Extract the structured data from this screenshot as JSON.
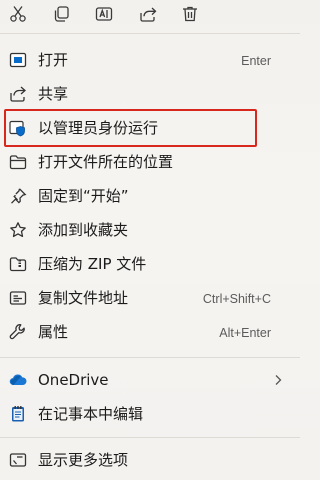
{
  "toolbar": {
    "buttons": [
      {
        "name": "cut-icon"
      },
      {
        "name": "copy-icon"
      },
      {
        "name": "rename-icon"
      },
      {
        "name": "share-icon"
      },
      {
        "name": "delete-icon"
      }
    ]
  },
  "menu": {
    "open": {
      "label": "打开",
      "shortcut": "Enter",
      "icon": "app-window-icon"
    },
    "share": {
      "label": "共享",
      "icon": "share-icon"
    },
    "run_as_admin": {
      "label": "以管理员身份运行",
      "icon": "shield-icon"
    },
    "open_location": {
      "label": "打开文件所在的位置",
      "icon": "folder-icon"
    },
    "pin_start": {
      "label": "固定到“开始”",
      "icon": "pin-icon"
    },
    "add_favorites": {
      "label": "添加到收藏夹",
      "icon": "star-icon"
    },
    "compress_zip": {
      "label": "压缩为 ZIP 文件",
      "icon": "zip-icon"
    },
    "copy_path": {
      "label": "复制文件地址",
      "shortcut": "Ctrl+Shift+C",
      "icon": "copy-path-icon"
    },
    "properties": {
      "label": "属性",
      "shortcut": "Alt+Enter",
      "icon": "wrench-icon"
    },
    "onedrive": {
      "label": "OneDrive",
      "icon": "cloud-icon"
    },
    "edit_notepad": {
      "label": "在记事本中编辑",
      "icon": "notepad-icon"
    },
    "more_options": {
      "label": "显示更多选项",
      "icon": "more-options-icon"
    }
  },
  "colors": {
    "accent": "#0a6cc9",
    "highlight_border": "#d8281e",
    "onedrive_blue": "#1a78d4"
  }
}
